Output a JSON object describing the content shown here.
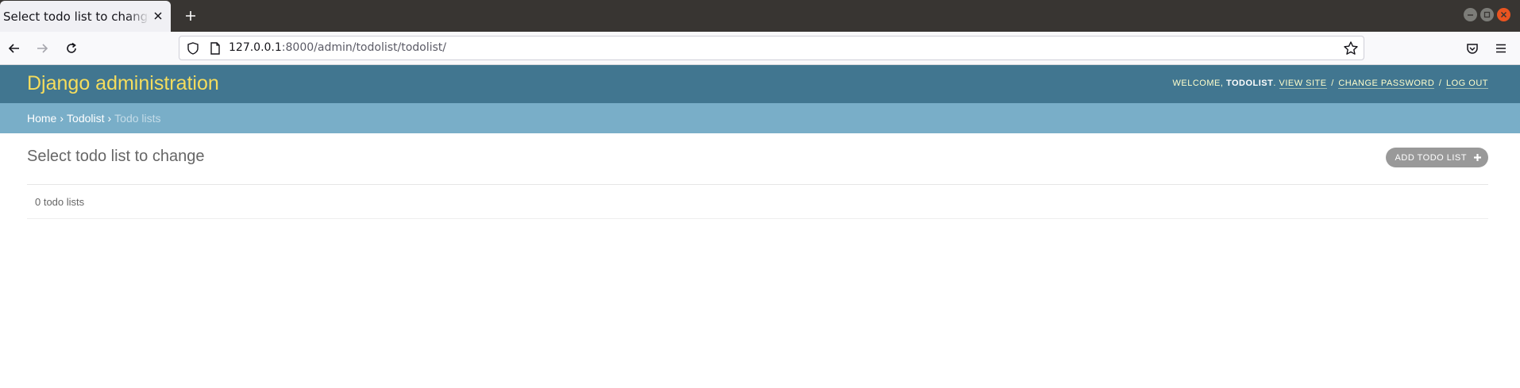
{
  "browser": {
    "tab_title": "Select todo list to change | Django site admin",
    "url_host": "127.0.0.1",
    "url_rest": ":8000/admin/todolist/todolist/"
  },
  "header": {
    "branding": "Django administration",
    "welcome": "Welcome,",
    "username": "todolist",
    "period": ".",
    "view_site": "View site",
    "change_password": "Change password",
    "log_out": "Log out",
    "separator": "/"
  },
  "breadcrumbs": {
    "home": "Home",
    "app": "Todolist",
    "current": "Todo lists",
    "arrow": "›"
  },
  "content": {
    "title": "Select todo list to change",
    "add_button": "Add todo list",
    "result_count": "0 todo lists"
  },
  "colors": {
    "header_bg": "#417690",
    "branding": "#f5dd5d",
    "breadcrumbs_bg": "#79aec8",
    "add_button_bg": "#999999"
  }
}
